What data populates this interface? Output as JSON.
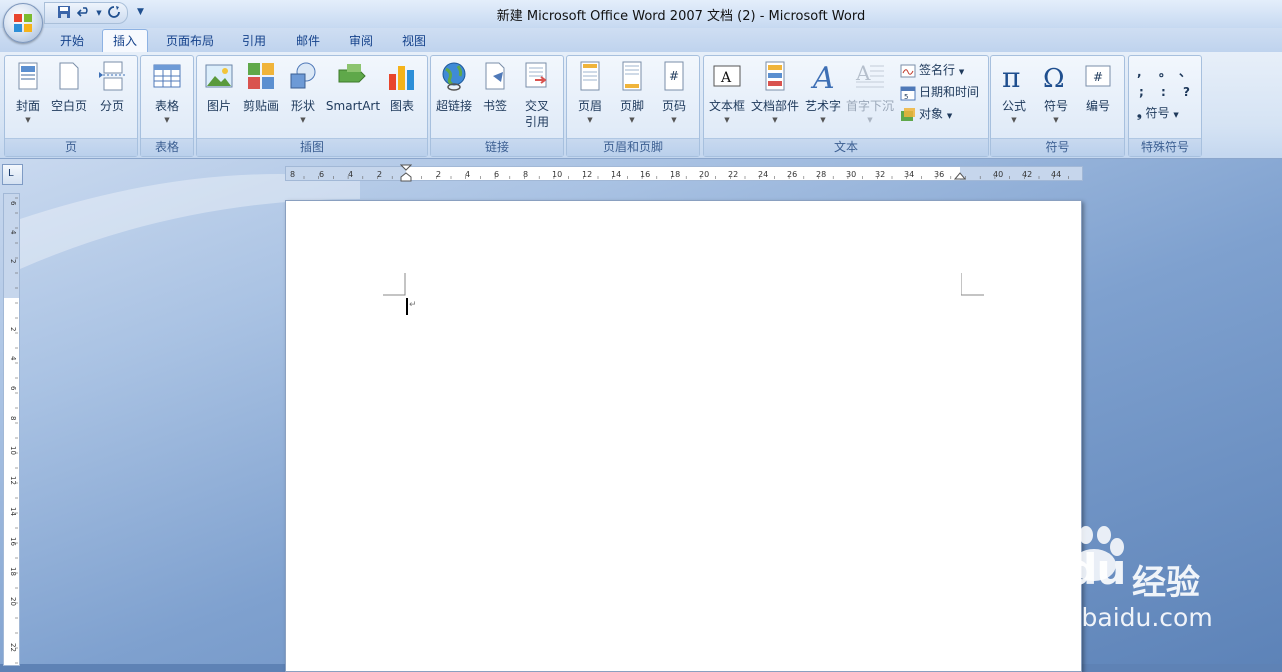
{
  "window": {
    "title": "新建 Microsoft Office Word 2007 文档 (2) - Microsoft Word"
  },
  "quick_access": {
    "save": "save-icon",
    "undo": "undo-icon",
    "redo": "redo-icon",
    "more": "▼"
  },
  "tabs": [
    "开始",
    "插入",
    "页面布局",
    "引用",
    "邮件",
    "审阅",
    "视图"
  ],
  "active_tab": "插入",
  "ribbon": {
    "groups": {
      "pages": {
        "label": "页",
        "buttons": [
          "封面",
          "空白页",
          "分页"
        ]
      },
      "tables": {
        "label": "表格",
        "buttons": [
          "表格"
        ]
      },
      "illustrations": {
        "label": "插图",
        "buttons": [
          "图片",
          "剪贴画",
          "形状",
          "SmartArt",
          "图表"
        ]
      },
      "links": {
        "label": "链接",
        "buttons": [
          "超链接",
          "书签",
          "交叉",
          "引用"
        ]
      },
      "header_footer": {
        "label": "页眉和页脚",
        "buttons": [
          "页眉",
          "页脚",
          "页码"
        ]
      },
      "text": {
        "label": "文本",
        "buttons": [
          "文本框",
          "文档部件",
          "艺术字",
          "首字下沉"
        ],
        "small": [
          "签名行",
          "日期和时间",
          "对象"
        ]
      },
      "symbols": {
        "label": "符号",
        "buttons": [
          "公式",
          "符号",
          "编号"
        ]
      },
      "special_symbols": {
        "label": "特殊符号",
        "chars": [
          ",",
          "。",
          "、",
          ";",
          ":",
          "?"
        ],
        "button": "符号"
      }
    }
  },
  "ruler": {
    "corner": "L",
    "h_ticks": [
      "8",
      "6",
      "4",
      "2",
      "2",
      "4",
      "6",
      "8",
      "10",
      "12",
      "14",
      "16",
      "18",
      "20",
      "22",
      "24",
      "26",
      "28",
      "30",
      "32",
      "34",
      "36",
      "40",
      "42",
      "44"
    ],
    "v_ticks": [
      "6",
      "4",
      "2",
      "2",
      "4",
      "6",
      "8",
      "10",
      "12",
      "14",
      "16",
      "18",
      "20",
      "22"
    ]
  },
  "watermark": {
    "logo": "Bai du",
    "text": "经验",
    "url": "jingyan.baidu.com"
  }
}
